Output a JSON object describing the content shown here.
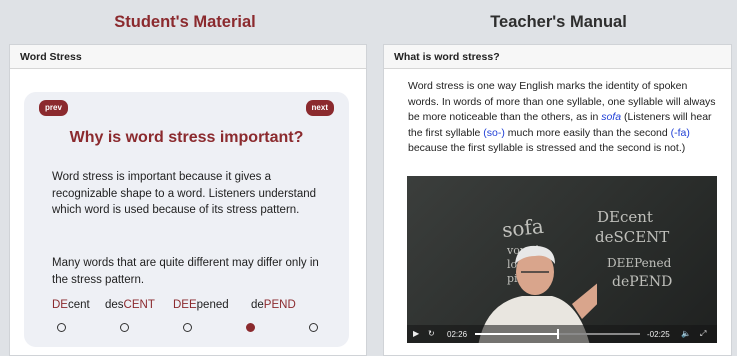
{
  "left_title": "Student's Material",
  "right_title": "Teacher's Manual",
  "student": {
    "header": "Word Stress",
    "prev_label": "prev",
    "next_label": "next",
    "card_title": "Why is word stress important?",
    "para1": "Word stress is important because it gives a recognizable shape to a word. Listeners understand which word is used because of its stress pattern.",
    "para2": "Many words that are quite different may differ only in the stress pattern.",
    "words": [
      {
        "stressed": "DE",
        "rest": "cent"
      },
      {
        "pre": "des",
        "stressed": "CENT"
      },
      {
        "stressed": "DEE",
        "rest": "pened"
      },
      {
        "pre": "de",
        "stressed": "PEND"
      }
    ],
    "slides_total": 5,
    "current_slide": 4
  },
  "teacher": {
    "header": "What is word stress?",
    "text_a": "Word stress is one way English marks the identity of spoken words. In words of more than one syllable, one syllable will always be more noticeable than the others, as in ",
    "example_word": "sofa",
    "text_b": " (Listeners will hear the first syllable ",
    "syllable1": "(so-)",
    "text_c": " much more easily than the second ",
    "syllable2": "(-fa)",
    "text_d": " because the first syllable is stressed and the second is not.)",
    "video": {
      "board_words": [
        "sofa",
        "DEcent",
        "deSCENT",
        "DEEPened",
        "dePEND"
      ],
      "board_list": [
        "vowel",
        "longer",
        "pitch"
      ],
      "time_elapsed": "02:26",
      "time_remaining": "-02:25",
      "progress": 0.5
    }
  },
  "colors": {
    "accent": "#8b2a2e",
    "link": "#1f3fd6"
  }
}
